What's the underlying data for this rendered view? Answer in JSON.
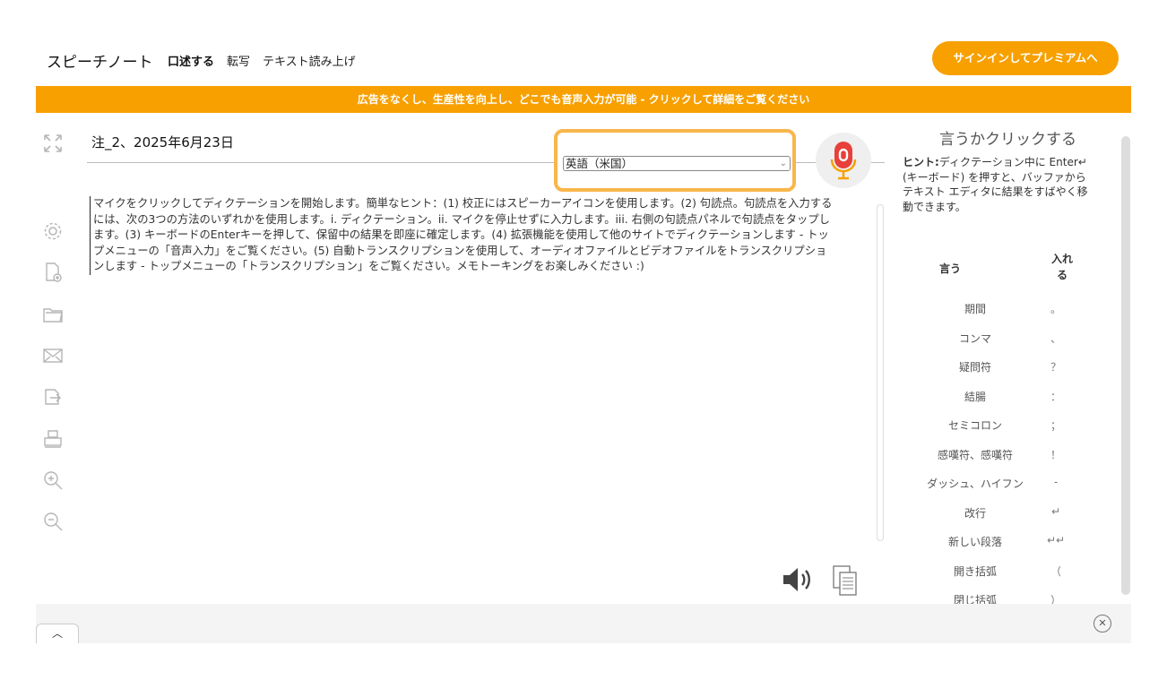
{
  "header": {
    "brand": "スピーチノート",
    "nav": [
      "口述する",
      "転写",
      "テキスト読み上げ"
    ],
    "signin_label": "サインインしてプレミアムへ"
  },
  "promo": "広告をなくし、生産性を向上し、どこでも音声入力が可能 - クリックして詳細をご覧ください",
  "note": {
    "title": "注_2、2025年6月23日",
    "language": "英語（米国）",
    "body": "マイクをクリックしてディクテーションを開始します。簡単なヒント：(1) 校正にはスピーカーアイコンを使用します。(2) 句読点。句読点を入力するには、次の3つの方法のいずれかを使用します。i. ディクテーション。ii. マイクを停止せずに入力します。iii. 右側の句読点パネルで句読点をタップします。(3) キーボードのEnterキーを押して、保留中の結果を即座に確定します。(4) 拡張機能を使用して他のサイトでディクテーションします - トップメニューの「音声入力」をご覧ください。(5) 自動トランスクリプションを使用して、オーディオファイルとビデオファイルをトランスクリプションします - トップメニューの「トランスクリプション」をご覧ください。メモトーキングをお楽しみください :)"
  },
  "right_panel": {
    "title": "言うかクリックする",
    "hint_label": "ヒント:",
    "hint_text": "ディクテーション中に Enter↵ (キーボード) を押すと、バッファからテキスト エディタに結果をすばやく移動できます。",
    "col_say": "言う",
    "col_insert": "入れる",
    "punctuation": [
      {
        "name": "期間",
        "symbol": "。"
      },
      {
        "name": "コンマ",
        "symbol": "、"
      },
      {
        "name": "疑問符",
        "symbol": "？"
      },
      {
        "name": "結腸",
        "symbol": "："
      },
      {
        "name": "セミコロン",
        "symbol": "；"
      },
      {
        "name": "感嘆符、感嘆符",
        "symbol": "！"
      },
      {
        "name": "ダッシュ、ハイフン",
        "symbol": "-"
      },
      {
        "name": "改行",
        "symbol": "↵"
      },
      {
        "name": "新しい段落",
        "symbol": "↵↵"
      },
      {
        "name": "開き括弧",
        "symbol": "（"
      },
      {
        "name": "閉じ括弧",
        "symbol": "）"
      }
    ]
  },
  "bottom": {
    "tab_icon": "chevron-up-icon",
    "close_icon": "close-circle-icon"
  },
  "colors": {
    "accent": "#f7a000",
    "mic": "#e8403a"
  }
}
